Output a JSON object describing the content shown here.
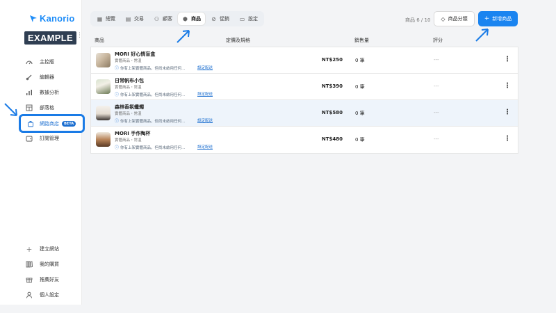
{
  "brand": {
    "name": "Kanorio",
    "workspace": "EXAMPLE",
    "accent": "#1a84f0"
  },
  "sidebar": {
    "items": [
      {
        "label": "主控版",
        "icon": "dashboard-icon"
      },
      {
        "label": "編輯器",
        "icon": "brush-icon"
      },
      {
        "label": "數據分析",
        "icon": "bar-chart-icon"
      },
      {
        "label": "部落格",
        "icon": "blog-icon"
      },
      {
        "label": "網路商店",
        "icon": "shop-bag-icon",
        "badge": "BETA",
        "active": true
      },
      {
        "label": "訂閱管理",
        "icon": "wallet-icon"
      }
    ],
    "bottom": [
      {
        "label": "建立網站",
        "icon": "plus-icon"
      },
      {
        "label": "我的購買",
        "icon": "library-icon"
      },
      {
        "label": "推薦好友",
        "icon": "gift-icon"
      },
      {
        "label": "個人設定",
        "icon": "user-icon"
      }
    ]
  },
  "tabs": [
    {
      "label": "總覽",
      "icon": "overview-icon"
    },
    {
      "label": "交易",
      "icon": "receipt-icon"
    },
    {
      "label": "顧客",
      "icon": "customers-icon"
    },
    {
      "label": "商品",
      "icon": "box-icon",
      "active": true
    },
    {
      "label": "促銷",
      "icon": "promo-icon"
    },
    {
      "label": "設定",
      "icon": "settings-icon"
    }
  ],
  "toolbar": {
    "count": "商品 6 / 10",
    "category_label": "商品分類",
    "new_label": "新增商品"
  },
  "table": {
    "headers": {
      "product": "商品",
      "price": "定價及規格",
      "sales": "銷售量",
      "rating": "評分"
    },
    "rows": [
      {
        "name": "MORI 好心情盲盒",
        "type": "實體商品・常溫",
        "note": "你有上架實體商品，但尚未啟用任何...",
        "link": "設定配送",
        "price": "NT$250",
        "sales": "0 筆",
        "rating": "---"
      },
      {
        "name": "日常帆布小包",
        "type": "實體商品・常溫",
        "note": "你有上架實體商品，但尚未啟用任何...",
        "link": "設定配送",
        "price": "NT$390",
        "sales": "0 筆",
        "rating": "---"
      },
      {
        "name": "森林香氛蠟燭",
        "type": "實體商品・常溫",
        "note": "你有上架實體商品，但尚未啟用任何...",
        "link": "設定配送",
        "price": "NT$580",
        "sales": "0 筆",
        "rating": "---"
      },
      {
        "name": "MORI 手作陶杯",
        "type": "實體商品・常溫",
        "note": "你有上架實體商品，但尚未啟用任何...",
        "link": "設定配送",
        "price": "NT$480",
        "sales": "0 筆",
        "rating": "---"
      }
    ]
  }
}
